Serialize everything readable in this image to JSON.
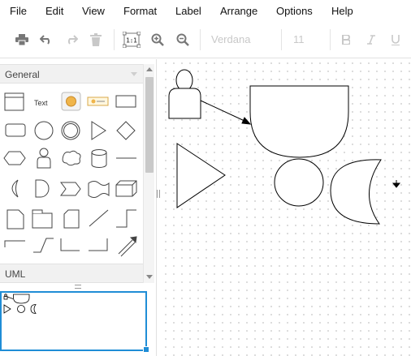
{
  "menubar": {
    "items": [
      "File",
      "Edit",
      "View",
      "Format",
      "Label",
      "Arrange",
      "Options",
      "Help"
    ]
  },
  "toolbar": {
    "font_family": "Verdana",
    "font_size": "11",
    "actual_size_label": "1:1",
    "buttons": [
      "print-icon",
      "undo-icon",
      "redo-icon",
      "delete-icon",
      "actual-size-icon",
      "zoom-in-icon",
      "zoom-out-icon",
      "bold-icon",
      "italic-icon",
      "underline-icon"
    ]
  },
  "sidebar": {
    "palettes": [
      {
        "title": "General",
        "expanded": true
      },
      {
        "title": "UML",
        "expanded": false
      }
    ],
    "text_shape_label": "Text"
  },
  "colors": {
    "accent": "#1f8dd6",
    "stroke": "#000000",
    "icon_gray": "#777777",
    "disabled_gray": "#c8c8c8",
    "grid_dot": "#d4d4d4"
  }
}
